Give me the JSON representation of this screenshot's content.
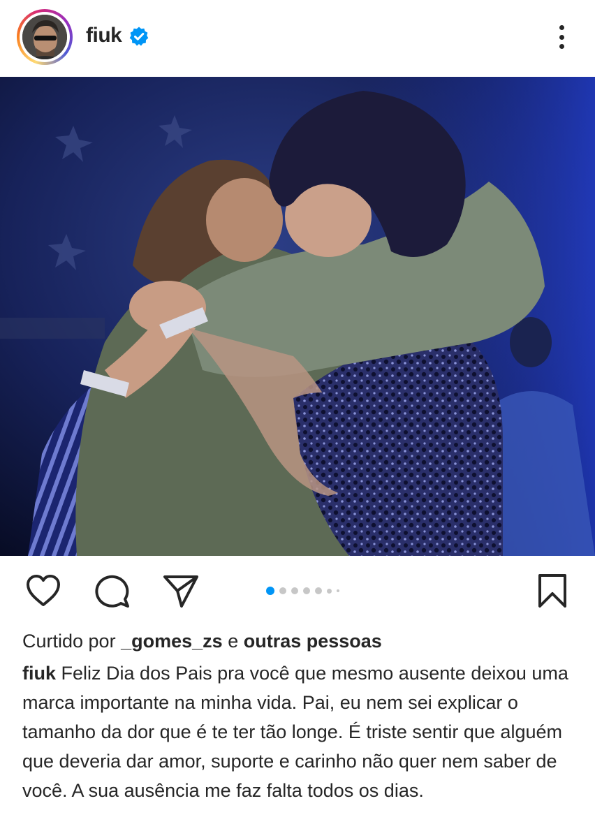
{
  "post": {
    "username": "fiuk",
    "verified": true,
    "menu_icon": "more-vertical-icon"
  },
  "carousel": {
    "total_dots": 7,
    "active_index": 0
  },
  "actions": {
    "like_icon": "heart-icon",
    "comment_icon": "comment-icon",
    "share_icon": "send-icon",
    "save_icon": "bookmark-icon"
  },
  "likes": {
    "prefix": "Curtido por",
    "user": "_gomes_zs",
    "joiner": "e",
    "others": "outras pessoas"
  },
  "caption": {
    "username": "fiuk",
    "text": "Feliz Dia dos Pais pra você que mesmo ausente deixou uma marca importante na minha vida. Pai, eu nem sei explicar o tamanho da dor que é te ter tão longe. É triste sentir que alguém que deveria dar amor, suporte e carinho não quer nem saber de você. A sua ausência me faz falta todos os dias."
  },
  "colors": {
    "text": "#262626",
    "verified_blue": "#0095f6",
    "dot_active": "#0095f6",
    "dot_inactive": "#c7c7c7"
  }
}
